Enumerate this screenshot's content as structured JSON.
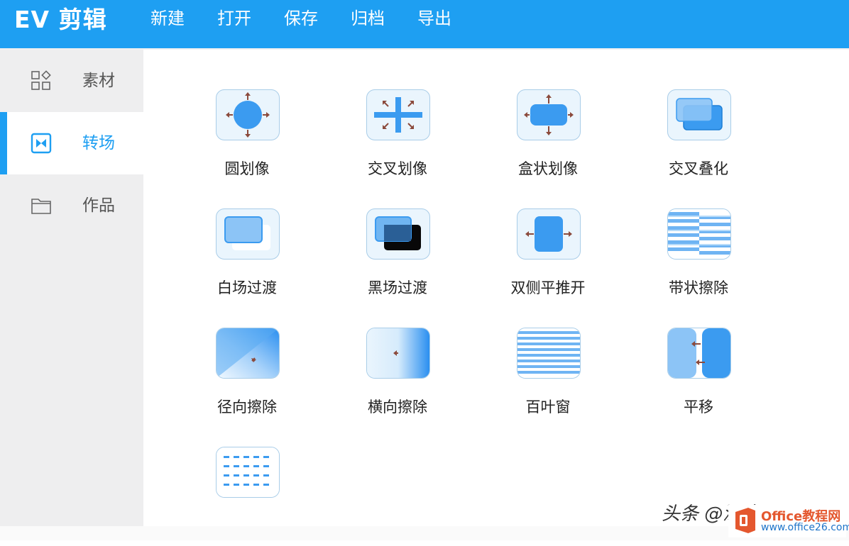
{
  "app": {
    "title": "EV 剪辑"
  },
  "menu": [
    "新建",
    "打开",
    "保存",
    "归档",
    "导出"
  ],
  "sidebar": {
    "items": [
      {
        "label": "素材",
        "icon": "grid-icon",
        "active": false
      },
      {
        "label": "转场",
        "icon": "transition-icon",
        "active": true
      },
      {
        "label": "作品",
        "icon": "folder-icon",
        "active": false
      }
    ]
  },
  "transitions": [
    {
      "label": "圆划像",
      "icon": "circle-wipe-icon"
    },
    {
      "label": "交叉划像",
      "icon": "cross-wipe-icon"
    },
    {
      "label": "盒状划像",
      "icon": "box-wipe-icon"
    },
    {
      "label": "交叉叠化",
      "icon": "cross-dissolve-icon"
    },
    {
      "label": "白场过渡",
      "icon": "white-fade-icon"
    },
    {
      "label": "黑场过渡",
      "icon": "black-fade-icon"
    },
    {
      "label": "双侧平推开",
      "icon": "double-push-icon"
    },
    {
      "label": "带状擦除",
      "icon": "band-wipe-icon"
    },
    {
      "label": "径向擦除",
      "icon": "radial-wipe-icon"
    },
    {
      "label": "横向擦除",
      "icon": "horizontal-wipe-icon"
    },
    {
      "label": "百叶窗",
      "icon": "blinds-icon"
    },
    {
      "label": "平移",
      "icon": "slide-icon"
    },
    {
      "label": "",
      "icon": "dots-icon"
    }
  ],
  "watermark": {
    "text": "头条 @深度Office",
    "site_name": "Office教程网",
    "site_url": "www.office26.com"
  },
  "colors": {
    "accent": "#1e9ff2",
    "icon_blue": "#3b9bf0",
    "arrow": "#8b4a3c"
  }
}
